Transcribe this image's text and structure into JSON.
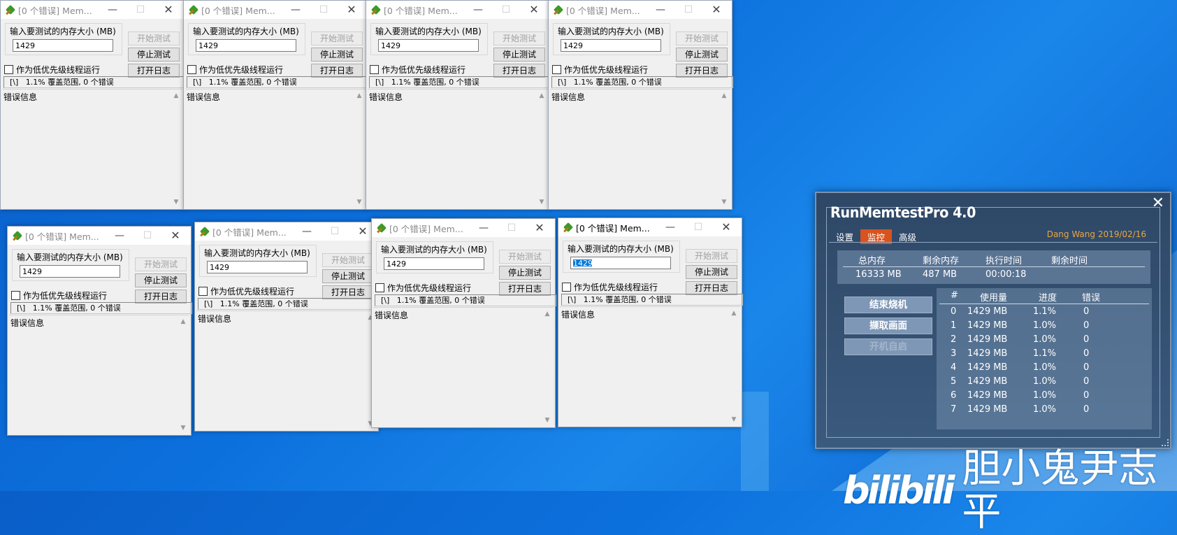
{
  "memtest_windows": [
    {
      "title": "[0 个错误] Mem...",
      "size_label": "输入要测试的内存大小 (MB)",
      "size_value": "1429",
      "start": "开始测试",
      "stop": "停止测试",
      "log": "打开日志",
      "low_priority": "作为低优先级线程运行",
      "status": "[\\]   1.1% 覆盖范围, 0 个错误",
      "errors": "错误信息"
    },
    {
      "title": "[0 个错误] Mem...",
      "size_label": "输入要测试的内存大小 (MB)",
      "size_value": "1429",
      "start": "开始测试",
      "stop": "停止测试",
      "log": "打开日志",
      "low_priority": "作为低优先级线程运行",
      "status": "[\\]   1.1% 覆盖范围, 0 个错误",
      "errors": "错误信息"
    },
    {
      "title": "[0 个错误] Mem...",
      "size_label": "输入要测试的内存大小 (MB)",
      "size_value": "1429",
      "start": "开始测试",
      "stop": "停止测试",
      "log": "打开日志",
      "low_priority": "作为低优先级线程运行",
      "status": "[\\]   1.1% 覆盖范围, 0 个错误",
      "errors": "错误信息"
    },
    {
      "title": "[0 个错误] Mem...",
      "size_label": "输入要测试的内存大小 (MB)",
      "size_value": "1429",
      "start": "开始测试",
      "stop": "停止测试",
      "log": "打开日志",
      "low_priority": "作为低优先级线程运行",
      "status": "[\\]   1.1% 覆盖范围, 0 个错误",
      "errors": "错误信息"
    },
    {
      "title": "[0 个错误] Mem...",
      "size_label": "输入要测试的内存大小 (MB)",
      "size_value": "1429",
      "start": "开始测试",
      "stop": "停止测试",
      "log": "打开日志",
      "low_priority": "作为低优先级线程运行",
      "status": "[\\]   1.1% 覆盖范围, 0 个错误",
      "errors": "错误信息"
    },
    {
      "title": "[0 个错误] Mem...",
      "size_label": "输入要测试的内存大小 (MB)",
      "size_value": "1429",
      "start": "开始测试",
      "stop": "停止测试",
      "log": "打开日志",
      "low_priority": "作为低优先级线程运行",
      "status": "[\\]   1.1% 覆盖范围, 0 个错误",
      "errors": "错误信息"
    },
    {
      "title": "[0 个错误] Mem...",
      "size_label": "输入要测试的内存大小 (MB)",
      "size_value": "1429",
      "start": "开始测试",
      "stop": "停止测试",
      "log": "打开日志",
      "low_priority": "作为低优先级线程运行",
      "status": "[\\]   1.1% 覆盖范围, 0 个错误",
      "errors": "错误信息"
    },
    {
      "title": "[0 个错误] Mem...",
      "size_label": "输入要测试的内存大小 (MB)",
      "size_value": "1429",
      "start": "开始测试",
      "stop": "停止测试",
      "log": "打开日志",
      "low_priority": "作为低优先级线程运行",
      "status": "[\\]   1.1% 覆盖范围, 0 个错误",
      "errors": "错误信息"
    }
  ],
  "runmemtest": {
    "title": "RunMemtestPro 4.0",
    "tabs": [
      "设置",
      "监控",
      "高级"
    ],
    "selected_tab": "监控",
    "author": "Dang Wang 2019/02/16",
    "summary_headers": [
      "总内存",
      "剩余内存",
      "执行时间",
      "剩余时间"
    ],
    "summary_values": [
      "16333 MB",
      "487 MB",
      "00:00:18",
      ""
    ],
    "actions": [
      "结束烧机",
      "撷取画面",
      "开机自启"
    ],
    "table_headers": [
      "#",
      "使用量",
      "进度",
      "错误"
    ],
    "rows": [
      [
        "0",
        "1429 MB",
        "1.1%",
        "0"
      ],
      [
        "1",
        "1429 MB",
        "1.0%",
        "0"
      ],
      [
        "2",
        "1429 MB",
        "1.0%",
        "0"
      ],
      [
        "3",
        "1429 MB",
        "1.1%",
        "0"
      ],
      [
        "4",
        "1429 MB",
        "1.0%",
        "0"
      ],
      [
        "5",
        "1429 MB",
        "1.0%",
        "0"
      ],
      [
        "6",
        "1429 MB",
        "1.0%",
        "0"
      ],
      [
        "7",
        "1429 MB",
        "1.0%",
        "0"
      ]
    ]
  },
  "watermark": {
    "logo": "bilibili",
    "name": "胆小鬼尹志平"
  },
  "colors": {
    "desktop": "#0c70dc",
    "accent_tab": "#d9531e",
    "author": "#e9a640",
    "panel": "#2e4766"
  }
}
